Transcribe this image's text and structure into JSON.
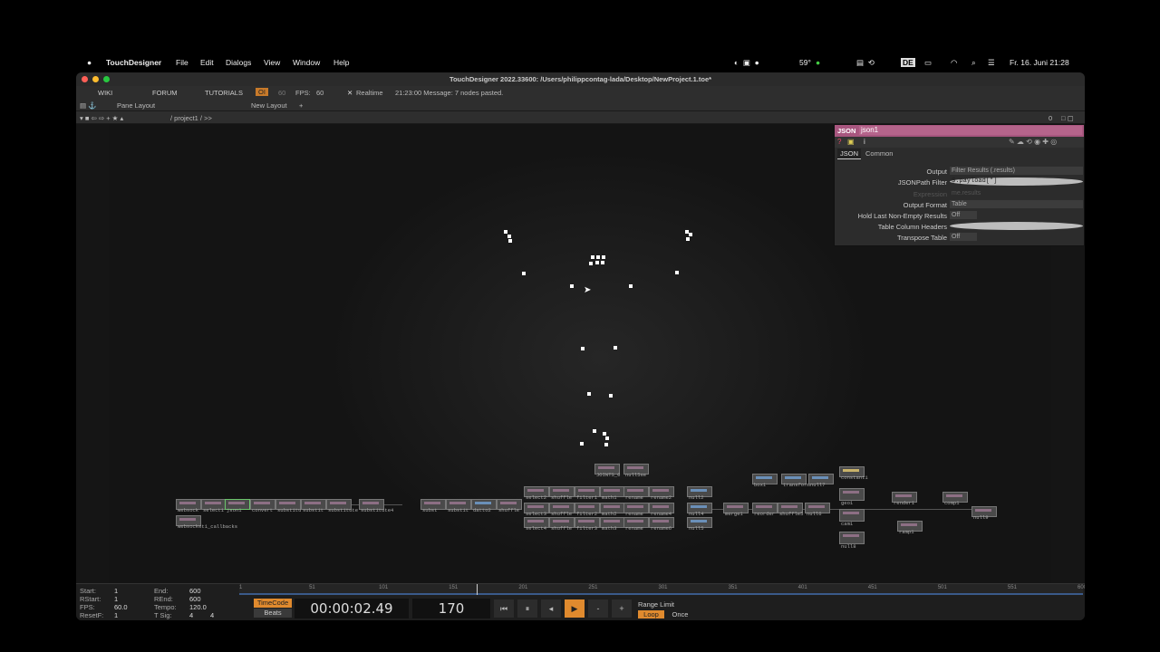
{
  "menubar": {
    "apple": "",
    "app": "TouchDesigner",
    "items": [
      "File",
      "Edit",
      "Dialogs",
      "View",
      "Window",
      "Help"
    ],
    "temp": "59°",
    "lang": "DE",
    "clock": "Fr. 16. Juni  21:28"
  },
  "window": {
    "title": "TouchDesigner 2022.33600: /Users/philippcontag-lada/Desktop/NewProject.1.toe*",
    "toolbar": {
      "wiki": "WIKI",
      "forum": "FORUM",
      "tutorials": "TUTORIALS",
      "oi": "OI",
      "fps_small": "60",
      "fps_label": "FPS:",
      "fps_value": "60",
      "realtime": "Realtime",
      "message": "21:23:00 Message: 7 nodes pasted."
    },
    "layoutbar": {
      "pane_layout": "Pane Layout",
      "new_layout": "New Layout"
    },
    "pathbar": {
      "path": "/ project1 / >>",
      "counter": "0"
    }
  },
  "params": {
    "op_type": "JSON",
    "op_name": "json1",
    "tabs": [
      "JSON",
      "Common"
    ],
    "rows": [
      {
        "label": "Output",
        "value": "Filter Results (.results)"
      },
      {
        "label": "JSONPath Filter",
        "value": "$.payload[*]"
      },
      {
        "label": "Expression",
        "value": "me.results"
      },
      {
        "label": "Output Format",
        "value": "Table"
      },
      {
        "label": "Hold Last Non-Empty Results",
        "value": "Off"
      },
      {
        "label": "Table Column Headers",
        "value": ""
      },
      {
        "label": "Transpose Table",
        "value": "Off"
      }
    ]
  },
  "operators": {
    "row1": [
      "websock",
      "select1",
      "json1",
      "convert",
      "substitu",
      "substit",
      "substitute",
      "substitute4"
    ],
    "row2": [
      "subst",
      "substit",
      "datto2",
      "shuffle"
    ],
    "grid": [
      "select2",
      "shuffle",
      "filter1",
      "math1",
      "rename",
      "rename2",
      "null2",
      "select3",
      "shuffle",
      "filter2",
      "math2",
      "rename",
      "rename4",
      "null4",
      "select4",
      "shuffle",
      "filter3",
      "math3",
      "rename",
      "rename6",
      "null5"
    ],
    "top": [
      "JOINTS_0",
      "null5se"
    ],
    "right": [
      "merge1",
      "reorder",
      "shuffle5",
      "null6",
      "box1",
      "transform",
      "null7",
      "constant1",
      "geo1",
      "cam1",
      "null8",
      "render1",
      "comp1",
      "null9",
      "ramp1"
    ],
    "callbacks": "websocket1_callbacks"
  },
  "timeline": {
    "start_label": "Start:",
    "start": "1",
    "end_label": "End:",
    "end": "600",
    "rstart_label": "RStart:",
    "rstart": "1",
    "rend_label": "REnd:",
    "rend": "600",
    "fps_label": "FPS:",
    "fps": "60.0",
    "tempo_label": "Tempo:",
    "tempo": "120.0",
    "resetf_label": "ResetF:",
    "resetf": "1",
    "tsig_label": "T Sig:",
    "tsig_a": "4",
    "tsig_b": "4",
    "ticks": [
      "1",
      "51",
      "101",
      "151",
      "201",
      "251",
      "301",
      "351",
      "401",
      "451",
      "501",
      "551",
      "600"
    ],
    "timecode_btn": "TimeCode",
    "beats_btn": "Beats",
    "timecode": "00:00:02.49",
    "frame": "170",
    "range_limit": "Range Limit",
    "loop": "Loop",
    "once": "Once",
    "colors": {
      "accent": "#e08a2e",
      "selected": "#ff9a3c"
    }
  }
}
